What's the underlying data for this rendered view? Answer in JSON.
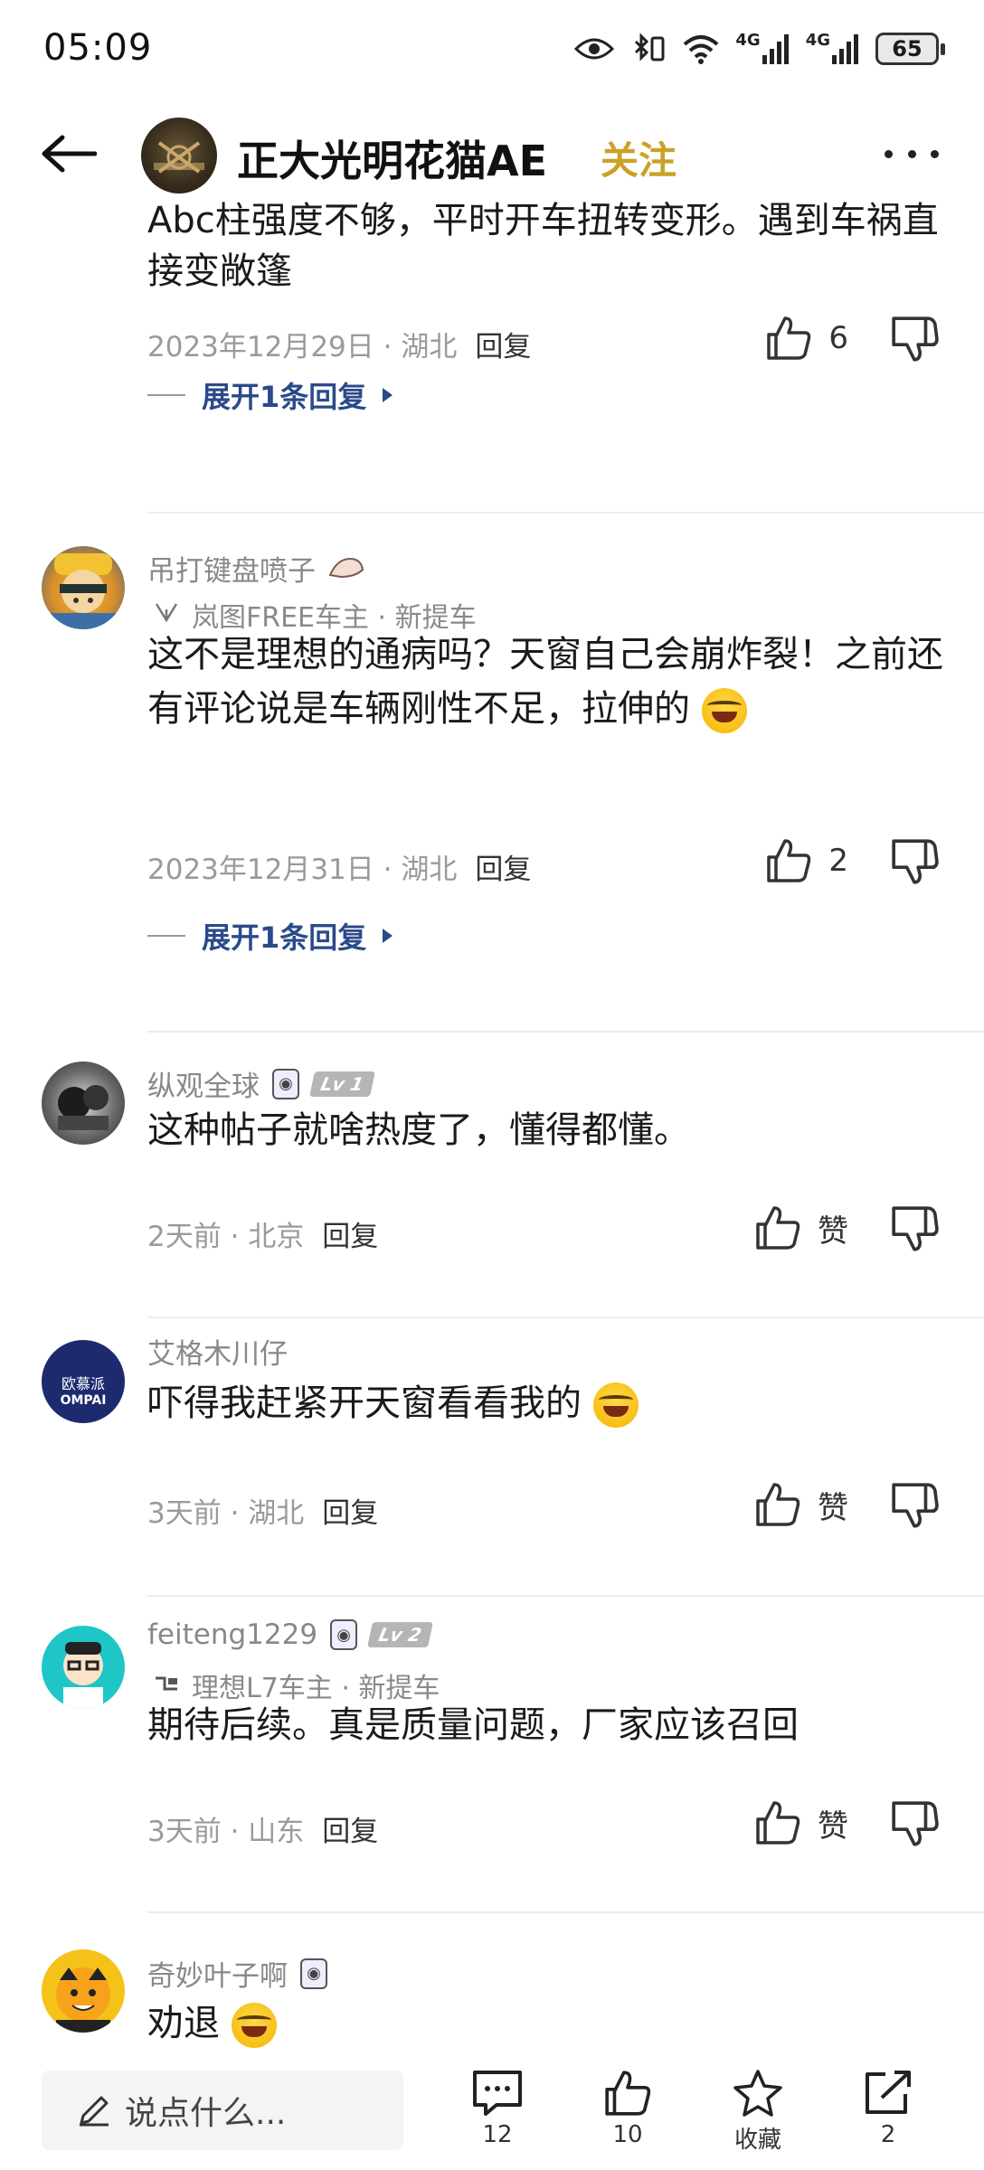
{
  "status_bar": {
    "time": "05:09",
    "network_1": "4G",
    "network_2": "4G",
    "battery": "65"
  },
  "header": {
    "title": "正大光明花猫AE",
    "follow_label": "关注"
  },
  "comments": [
    {
      "text": "Abc柱强度不够，平时开车扭转变形。遇到车祸直接变敞篷",
      "date": "2023年12月29日 · 湖北",
      "reply_label": "回复",
      "likes": "6",
      "expand_label": "展开1条回复"
    },
    {
      "name": "吊打键盘喷子",
      "car": "岚图FREE车主 · 新提车",
      "text": "这不是理想的通病吗？天窗自己会崩炸裂！之前还有评论说是车辆刚性不足，拉伸的",
      "date": "2023年12月31日 · 湖北",
      "reply_label": "回复",
      "likes": "2",
      "expand_label": "展开1条回复"
    },
    {
      "name": "纵观全球",
      "level": "Lv 1",
      "text": "这种帖子就啥热度了，懂得都懂。",
      "date": "2天前 · 北京",
      "reply_label": "回复",
      "likes": "赞"
    },
    {
      "name": "艾格木川仔",
      "avatar_text_top": "欧慕派",
      "avatar_text_bottom": "OMPAI",
      "text": "吓得我赶紧开天窗看看我的",
      "date": "3天前 · 湖北",
      "reply_label": "回复",
      "likes": "赞"
    },
    {
      "name": "feiteng1229",
      "level": "Lv 2",
      "car": "理想L7车主 · 新提车",
      "text": "期待后续。真是质量问题，厂家应该召回",
      "date": "3天前 · 山东",
      "reply_label": "回复",
      "likes": "赞"
    },
    {
      "name": "奇妙叶子啊",
      "text": "劝退"
    }
  ],
  "bottom_bar": {
    "input_placeholder": "说点什么...",
    "comments_count": "12",
    "likes_count": "10",
    "favorite_label": "收藏",
    "share_count": "2"
  },
  "colors": {
    "follow": "#c9a227",
    "expand_link": "#2a4a8a",
    "meta_text": "#9a9a9a"
  }
}
